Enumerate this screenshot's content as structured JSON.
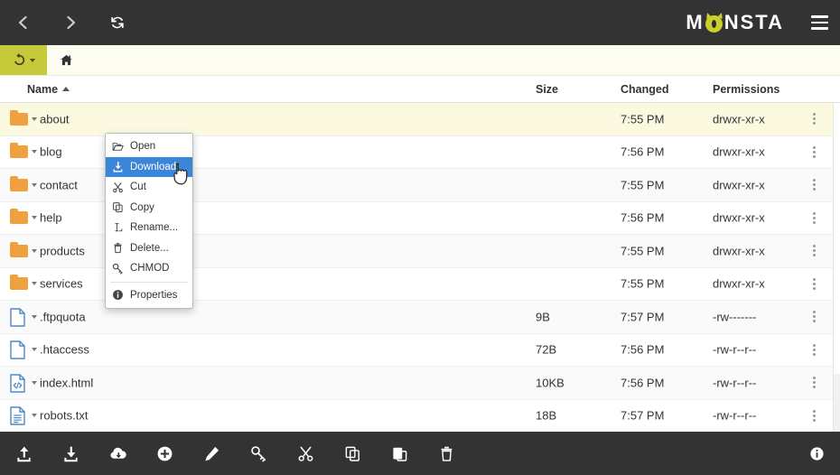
{
  "header": {
    "back_label": "Back",
    "forward_label": "Forward",
    "refresh_label": "Refresh",
    "logo_before": "M",
    "logo_after": "NSTA",
    "logo_eye": "monster-eye",
    "menu_label": "Menu"
  },
  "breadcrumb": {
    "history_label": "History",
    "home_label": "Home"
  },
  "columns": {
    "name": "Name",
    "size": "Size",
    "changed": "Changed",
    "permissions": "Permissions",
    "sort": "ascending"
  },
  "files": [
    {
      "name": "about",
      "type": "folder",
      "icon": "folder-icon",
      "size": "",
      "changed": "7:55 PM",
      "permissions": "drwxr-xr-x",
      "selected": true
    },
    {
      "name": "blog",
      "type": "folder",
      "icon": "folder-icon",
      "size": "",
      "changed": "7:56 PM",
      "permissions": "drwxr-xr-x",
      "selected": false
    },
    {
      "name": "contact",
      "type": "folder",
      "icon": "folder-icon",
      "size": "",
      "changed": "7:55 PM",
      "permissions": "drwxr-xr-x",
      "selected": false
    },
    {
      "name": "help",
      "type": "folder",
      "icon": "folder-icon",
      "size": "",
      "changed": "7:56 PM",
      "permissions": "drwxr-xr-x",
      "selected": false
    },
    {
      "name": "products",
      "type": "folder",
      "icon": "folder-icon",
      "size": "",
      "changed": "7:55 PM",
      "permissions": "drwxr-xr-x",
      "selected": false
    },
    {
      "name": "services",
      "type": "folder",
      "icon": "folder-icon",
      "size": "",
      "changed": "7:55 PM",
      "permissions": "drwxr-xr-x",
      "selected": false
    },
    {
      "name": ".ftpquota",
      "type": "file",
      "icon": "file-blank-icon",
      "size": "9B",
      "changed": "7:57 PM",
      "permissions": "-rw-------",
      "selected": false
    },
    {
      "name": ".htaccess",
      "type": "file",
      "icon": "file-blank-icon",
      "size": "72B",
      "changed": "7:56 PM",
      "permissions": "-rw-r--r--",
      "selected": false
    },
    {
      "name": "index.html",
      "type": "file",
      "icon": "file-code-icon",
      "size": "10KB",
      "changed": "7:56 PM",
      "permissions": "-rw-r--r--",
      "selected": false
    },
    {
      "name": "robots.txt",
      "type": "file",
      "icon": "file-text-icon",
      "size": "18B",
      "changed": "7:57 PM",
      "permissions": "-rw-r--r--",
      "selected": false
    }
  ],
  "context_menu": {
    "items": [
      {
        "label": "Open",
        "icon": "folder-open-icon",
        "active": false,
        "separator_after": false
      },
      {
        "label": "Download",
        "icon": "download-icon",
        "active": true,
        "separator_after": false
      },
      {
        "label": "Cut",
        "icon": "scissors-icon",
        "active": false,
        "separator_after": false
      },
      {
        "label": "Copy",
        "icon": "copy-icon",
        "active": false,
        "separator_after": false
      },
      {
        "label": "Rename...",
        "icon": "text-cursor-icon",
        "active": false,
        "separator_after": false
      },
      {
        "label": "Delete...",
        "icon": "trash-icon",
        "active": false,
        "separator_after": false
      },
      {
        "label": "CHMOD",
        "icon": "key-icon",
        "active": false,
        "separator_after": true
      },
      {
        "label": "Properties",
        "icon": "info-icon",
        "active": false,
        "separator_after": false
      }
    ]
  },
  "bottom_toolbar": {
    "buttons": [
      {
        "icon": "upload-icon",
        "label": "Upload"
      },
      {
        "icon": "download-icon",
        "label": "Download"
      },
      {
        "icon": "cloud-download-icon",
        "label": "Remote download"
      },
      {
        "icon": "plus-circle-icon",
        "label": "New"
      },
      {
        "icon": "pencil-icon",
        "label": "Edit"
      },
      {
        "icon": "key-icon",
        "label": "CHMOD"
      },
      {
        "icon": "scissors-icon",
        "label": "Cut"
      },
      {
        "icon": "copy-icon",
        "label": "Copy"
      },
      {
        "icon": "paste-icon",
        "label": "Paste"
      },
      {
        "icon": "trash-icon",
        "label": "Delete"
      }
    ],
    "info": {
      "icon": "info-icon",
      "label": "Info"
    }
  },
  "colors": {
    "chrome_dark": "#333333",
    "accent_olive": "#c6c93a",
    "highlight_blue": "#3b86d8",
    "selected_row": "#fbfae1",
    "folder_orange": "#f0a13f",
    "file_blue": "#4a89c8"
  }
}
